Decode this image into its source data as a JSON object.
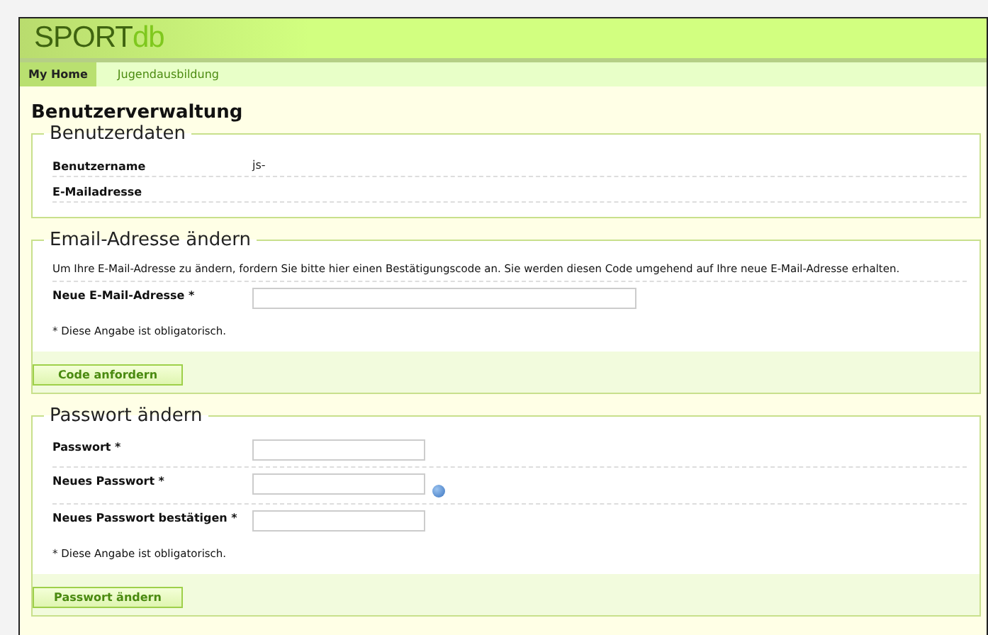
{
  "logo": {
    "primary": "SPORT",
    "secondary": "db"
  },
  "tabs": [
    {
      "label": "My Home",
      "selected": true
    },
    {
      "label": "Jugendausbildung",
      "selected": false
    }
  ],
  "page_title": "Benutzerverwaltung",
  "sections": [
    {
      "legend": "Benutzerdaten",
      "rows": [
        {
          "kind": "info",
          "label": "Benutzername",
          "value": "js-"
        },
        {
          "kind": "info",
          "label": "E-Mailadresse"
        }
      ]
    },
    {
      "legend": "Email-Adresse ändern",
      "intro": "Um Ihre E-Mail-Adresse zu ändern, fordern Sie bitte hier einen Bestätigungscode an. Sie werden diesen Code umgehend auf Ihre neue E-Mail-Adresse erhalten.",
      "rows": [
        {
          "kind": "email",
          "label": "Neue E-Mail-Adresse *"
        }
      ],
      "note": "* Diese Angabe ist obligatorisch.",
      "button": "Code anfordern"
    },
    {
      "legend": "Passwort ändern",
      "rows": [
        {
          "kind": "password",
          "label": "Passwort *"
        },
        {
          "kind": "password-help",
          "label": "Neues Passwort *"
        },
        {
          "kind": "password",
          "label": "Neues Passwort bestätigen *"
        }
      ],
      "note": "* Diese Angabe ist obligatorisch.",
      "button": "Passwort ändern"
    }
  ]
}
